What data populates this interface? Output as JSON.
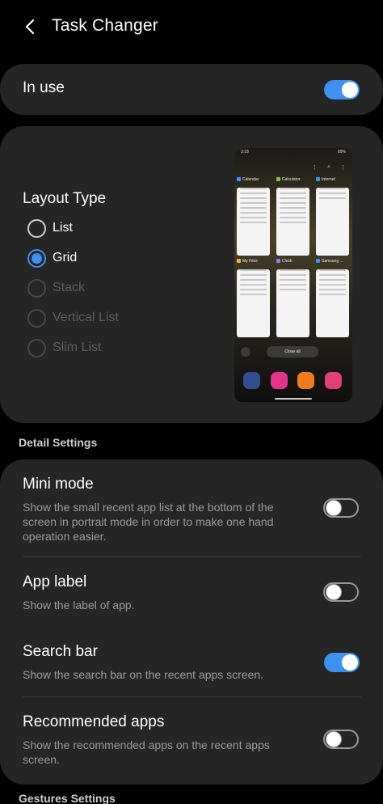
{
  "header": {
    "title": "Task Changer"
  },
  "in_use": {
    "label": "In use",
    "enabled": true
  },
  "layout": {
    "title": "Layout Type",
    "options": [
      {
        "label": "List",
        "selected": false,
        "disabled": false
      },
      {
        "label": "Grid",
        "selected": true,
        "disabled": false
      },
      {
        "label": "Stack",
        "selected": false,
        "disabled": true
      },
      {
        "label": "Vertical List",
        "selected": false,
        "disabled": true
      },
      {
        "label": "Slim List",
        "selected": false,
        "disabled": true
      }
    ],
    "preview": {
      "time": "3:18",
      "battery": "89%",
      "apps": [
        "Calendar",
        "Calculator",
        "Internet",
        "My Files",
        "Clock",
        "Samsung ..."
      ],
      "close_all": "Close all",
      "app_colors": [
        "#3e91ef",
        "#7bc043",
        "#3e91ef",
        "#f2b233",
        "#8a7cf0",
        "#3e91ef"
      ],
      "dock_colors": [
        "#2f4f8f",
        "#e3348b",
        "#f07a1e",
        "#e0407a"
      ]
    }
  },
  "detail_settings": {
    "header": "Detail Settings",
    "items": [
      {
        "title": "Mini mode",
        "desc": "Show the small recent app list at the bottom of the screen in portrait mode in order to make one hand operation easier.",
        "enabled": false
      },
      {
        "title": "App label",
        "desc": "Show the label of app.",
        "enabled": false
      },
      {
        "title": "Search bar",
        "desc": "Show the search bar on the recent apps screen.",
        "enabled": true
      },
      {
        "title": "Recommended apps",
        "desc": "Show the recommended apps on the recent apps screen.",
        "enabled": false
      }
    ]
  },
  "gestures_settings": {
    "header": "Gestures Settings"
  },
  "colors": {
    "accent": "#3e91ef",
    "card": "#252525",
    "background": "#000000"
  }
}
